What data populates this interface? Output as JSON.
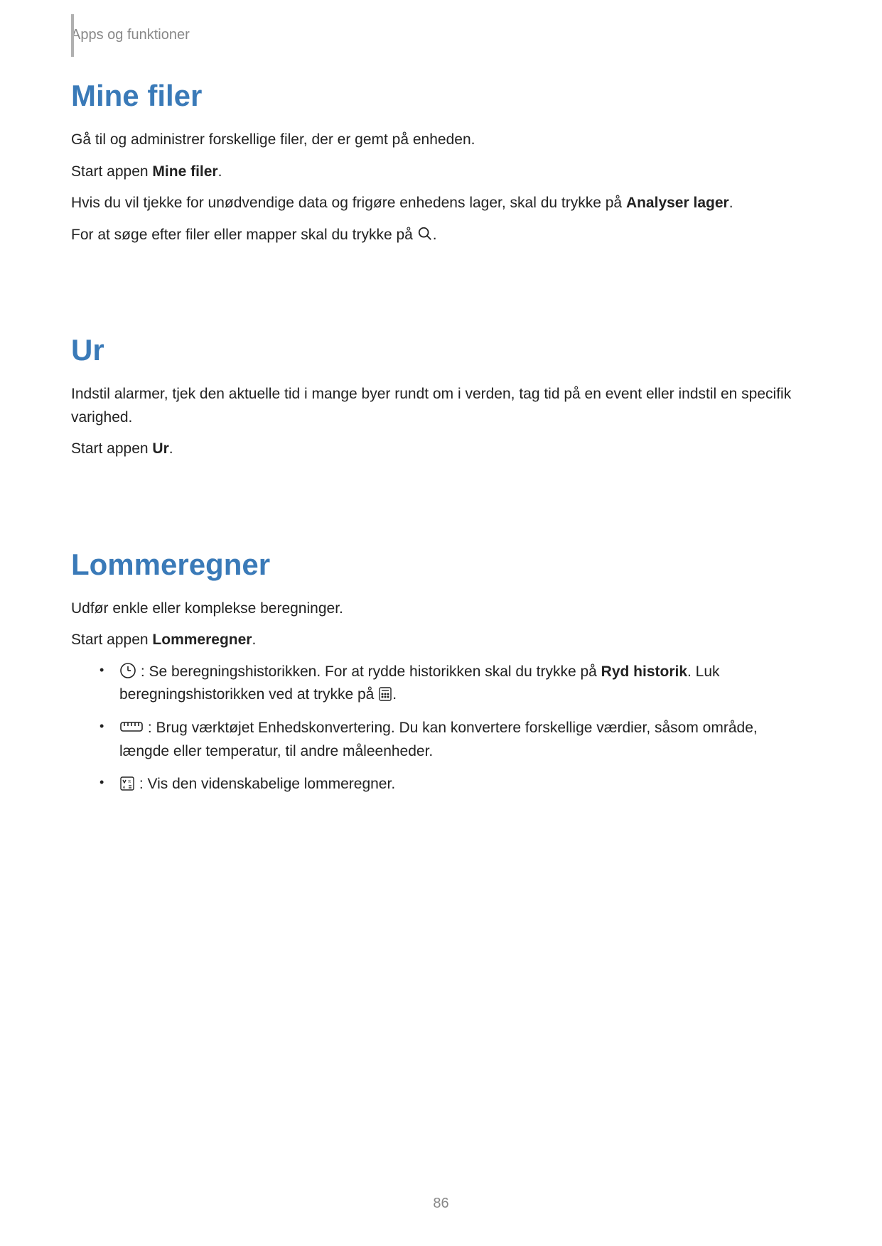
{
  "breadcrumb": "Apps og funktioner",
  "page_number": "86",
  "sections": {
    "mine_filer": {
      "title": "Mine filer",
      "p1": "Gå til og administrer forskellige filer, der er gemt på enheden.",
      "p2_pre": "Start appen ",
      "p2_bold": "Mine filer",
      "p2_post": ".",
      "p3_pre": "Hvis du vil tjekke for unødvendige data og frigøre enhedens lager, skal du trykke på ",
      "p3_bold": "Analyser lager",
      "p3_post": ".",
      "p4_pre": "For at søge efter filer eller mapper skal du trykke på ",
      "p4_post": "."
    },
    "ur": {
      "title": "Ur",
      "p1": "Indstil alarmer, tjek den aktuelle tid i mange byer rundt om i verden, tag tid på en event eller indstil en specifik varighed.",
      "p2_pre": "Start appen ",
      "p2_bold": "Ur",
      "p2_post": "."
    },
    "lommeregner": {
      "title": "Lommeregner",
      "p1": "Udfør enkle eller komplekse beregninger.",
      "p2_pre": "Start appen ",
      "p2_bold": "Lommeregner",
      "p2_post": ".",
      "bullets": {
        "b1_pre": " : Se beregningshistorikken. For at rydde historikken skal du trykke på ",
        "b1_bold": "Ryd historik",
        "b1_mid": ". Luk beregningshistorikken ved at trykke på ",
        "b1_post": ".",
        "b2": " : Brug værktøjet Enhedskonvertering. Du kan konvertere forskellige værdier, såsom område, længde eller temperatur, til andre måleenheder.",
        "b3": " : Vis den videnskabelige lommeregner."
      }
    }
  }
}
